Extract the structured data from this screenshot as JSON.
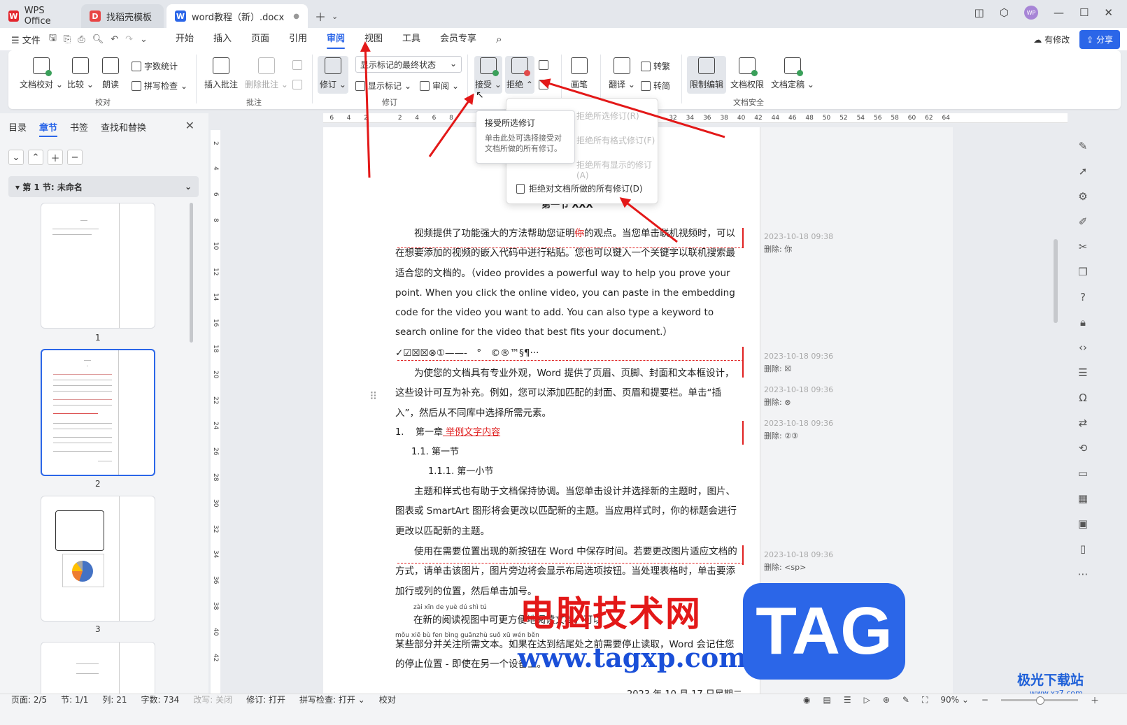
{
  "titlebar": {
    "tabs": [
      {
        "label": "WPS Office"
      },
      {
        "label": "找稻壳模板"
      },
      {
        "label": "word教程（新）.docx"
      }
    ],
    "avatar": "WP"
  },
  "menubar": {
    "file": "文件",
    "tabs": [
      "开始",
      "插入",
      "页面",
      "引用",
      "审阅",
      "视图",
      "工具",
      "会员专享"
    ],
    "active_tab": "审阅",
    "modify_label": "有修改",
    "share_label": "分享"
  },
  "ribbon": {
    "proof": {
      "doc_proof": "文档校对",
      "compare": "比较",
      "read_aloud": "朗读",
      "word_count": "字数统计",
      "spell_check": "拼写检查",
      "group": "校对"
    },
    "comments": {
      "insert": "插入批注",
      "delete": "删除批注",
      "group": "批注"
    },
    "revisions": {
      "track": "修订",
      "show_select": "显示标记的最终状态",
      "show_marks": "显示标记",
      "review": "审阅",
      "group": "修订"
    },
    "changes": {
      "accept": "接受",
      "reject": "拒绝"
    },
    "ink": {
      "pen": "画笔"
    },
    "translate": {
      "translate": "翻译",
      "to_traditional": "转繁",
      "to_simplified": "转简"
    },
    "security": {
      "restrict": "限制编辑",
      "permissions": "文档权限",
      "finalize": "文档定稿",
      "group": "文档安全"
    }
  },
  "leftpane": {
    "tabs": [
      "目录",
      "章节",
      "书签",
      "查找和替换"
    ],
    "active_tab": "章节",
    "section": "第 1 节: 未命名",
    "pages": [
      "1",
      "2",
      "3"
    ]
  },
  "ruler": {
    "h_ticks": [
      "6",
      "4",
      "2",
      "",
      "2",
      "4",
      "6",
      "8",
      "",
      "",
      "",
      "",
      "",
      "",
      "",
      "",
      "",
      "",
      "",
      "",
      "32",
      "34",
      "36",
      "38",
      "40",
      "42",
      "44",
      "46",
      "48",
      "50",
      "52",
      "54",
      "56",
      "58",
      "60",
      "62",
      "64"
    ],
    "v_ticks": [
      "2",
      "4",
      "6",
      "8",
      "10",
      "12",
      "14",
      "16",
      "18",
      "20",
      "22",
      "24",
      "26",
      "28",
      "30",
      "32",
      "34",
      "36",
      "38",
      "40",
      "42"
    ]
  },
  "dropdown": {
    "items": [
      "拒绝所选修订(R)",
      "拒绝所有格式修订(F)",
      "拒绝所有显示的修订(A)",
      "拒绝对文档所做的所有修订(D)"
    ]
  },
  "tooltip": {
    "title": "接受所选修订",
    "desc": "单击此处可选择接受对文档所做的所有修订。"
  },
  "document": {
    "heading": "第一节 XXX",
    "p1_a": "视频提供了功能强大的方法帮助您证明",
    "p1_del": "你",
    "p1_b": "的观点。当您单击联机视频时，可以在想要添加的视频的嵌入代码中进行粘贴。您也可以键入一个关键字以联机搜索最适合您的文档的。（video provides a powerful way to help you prove your point. When you click the online video, you can paste in the embedding code for the video you want to add. You can also type a keyword to search online for the video that best fits your document.）",
    "symbols": "✓☑☒☒⊗①——-　°　©®™§¶···",
    "p2": "为使您的文档具有专业外观，Word 提供了页眉、页脚、封面和文本框设计，这些设计可互为补充。例如，您可以添加匹配的封面、页眉和提要栏。单击“插入”，然后从不同库中选择所需元素。",
    "list1_num": "1.",
    "list1": "第一章",
    "list1_ins": " 举例文字内容",
    "list11": "1.1.  第一节",
    "list111": "1.1.1.   第一小节",
    "p3": "主题和样式也有助于文档保持协调。当您单击设计并选择新的主题时，图片、图表或 SmartArt 图形将会更改以匹配新的主题。当应用样式时，你的标题会进行更改以匹配新的主题。",
    "p4": "使用在需要位置出现的新按钮在 Word 中保存时间。若要更改图片适应文档的方式，请单击该图片，图片旁边将会显示布局选项按钮。当处理表格时，单击要添加行或列的位置，然后单击加号。",
    "pinyin1": "zài   xīn   de  yuè   dú   shì   tú",
    "p5": "在新的阅读视图中可更方便地阅读文档，可以",
    "pinyin2": "mǒu xiē  bù  fen bìng guānzhù suǒ xū wén běn",
    "p6": "某些部分并关注所需文本。如果在达到结尾处之前需要停止读取，Word 会记住您的停止位置 - 即使在另一个设备上。",
    "date": "2023 年 10 月 17 日星期二"
  },
  "revisions": [
    {
      "time": "2023-10-18 09:38",
      "label": "删除: 你"
    },
    {
      "time": "2023-10-18 09:36",
      "label": "删除: ☒"
    },
    {
      "time": "2023-10-18 09:36",
      "label": "删除: ⊗"
    },
    {
      "time": "2023-10-18 09:36",
      "label": "删除: ②③"
    },
    {
      "time": "2023-10-18 09:36",
      "label": "删除: <sp>"
    }
  ],
  "statusbar": {
    "page": "页面: 2/5",
    "section": "节: 1/1",
    "column": "列: 21",
    "words": "字数: 734",
    "overwrite": "改写: 关闭",
    "track": "修订: 打开",
    "spell": "拼写检查: 打开",
    "proof": "校对",
    "zoom": "90%"
  },
  "watermark": {
    "cn": "电脑技术网",
    "url": "www.tagxp.com",
    "tag": "TAG",
    "site": "极光下载站",
    "site_url": "www.xz7.com"
  },
  "colors": {
    "accent": "#2b66e8",
    "revision": "#e02020",
    "arrow": "#e31818"
  }
}
